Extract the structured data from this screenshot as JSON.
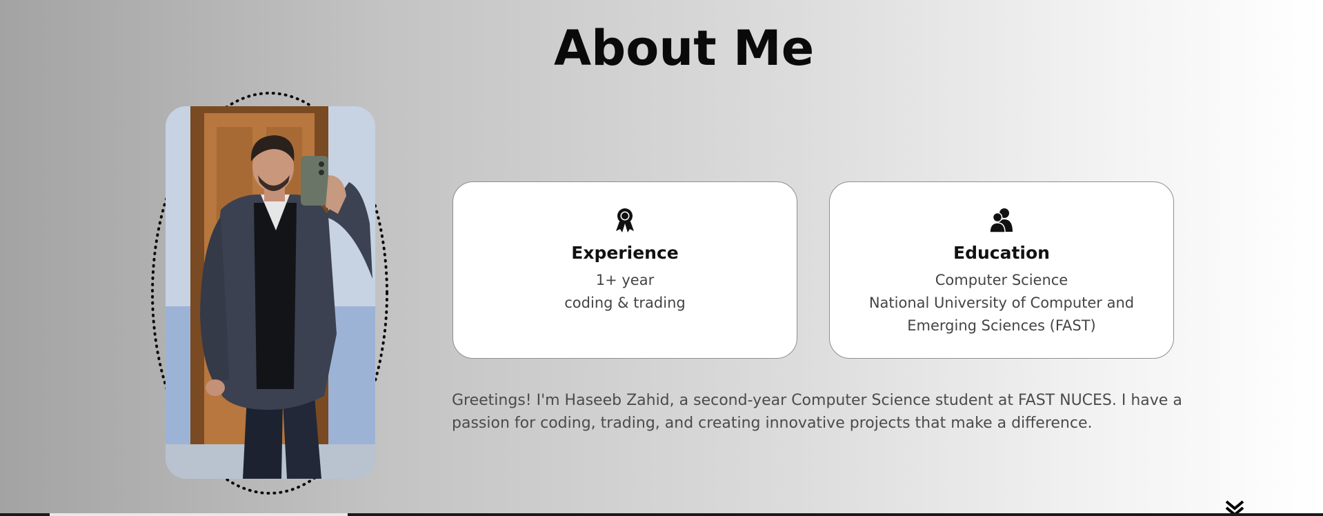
{
  "about": {
    "title": "About Me"
  },
  "cards": [
    {
      "icon": "award-icon",
      "title": "Experience",
      "lines": [
        "1+ year",
        "coding & trading"
      ]
    },
    {
      "icon": "users-icon",
      "title": "Education",
      "lines": [
        "Computer Science",
        "National University of Computer and",
        "Emerging Sciences (FAST)"
      ]
    }
  ],
  "bio": {
    "text": "Greetings! I'm Haseeb Zahid, a second-year Computer Science student at FAST NUCES. I have a passion for coding, trading, and creating innovative projects that make a difference."
  },
  "navigation": {
    "scroll_icon": "chevron-down-icon"
  },
  "colors": {
    "title": "#0a0a0a",
    "card_border": "#8e8e8e",
    "body_text": "#4b4b4b"
  }
}
